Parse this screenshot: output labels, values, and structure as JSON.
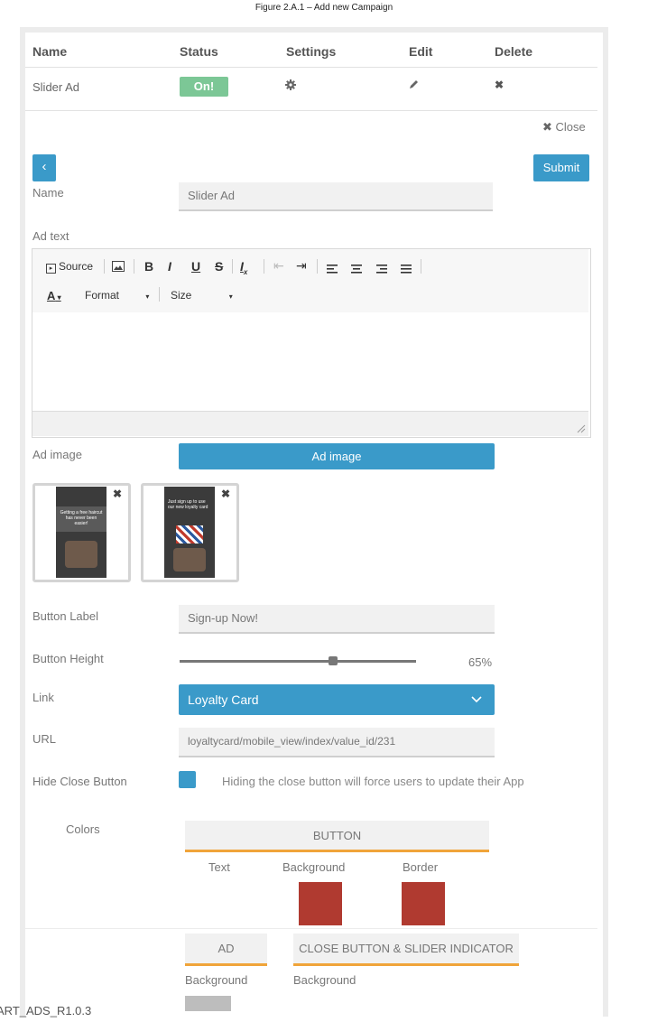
{
  "caption": "Figure 2.A.1 – Add new Campaign",
  "table": {
    "headers": [
      "Name",
      "Status",
      "Settings",
      "Edit",
      "Delete"
    ],
    "row": {
      "name": "Slider Ad",
      "status": "On!"
    }
  },
  "close_label": "Close",
  "back_label": "‹",
  "submit_label": "Submit",
  "form": {
    "name_label": "Name",
    "name_value": "Slider Ad",
    "ad_text_label": "Ad text",
    "ad_image_label": "Ad image",
    "ad_image_button": "Ad image",
    "button_label_label": "Button Label",
    "button_label_value": "Sign-up Now!",
    "button_height_label": "Button Height",
    "button_height_value": "65%",
    "button_height_fraction": 0.65,
    "link_label": "Link",
    "link_value": "Loyalty Card",
    "url_label": "URL",
    "url_value": "loyaltycard/mobile_view/index/value_id/231",
    "hide_close_label": "Hide Close Button",
    "hide_close_note": "Hiding the close button will force users to update their App",
    "colors_label": "Colors"
  },
  "editor": {
    "source": "Source",
    "format": "Format",
    "size": "Size"
  },
  "thumbs": [
    {
      "caption": "Getting a free haircut has never been easier!"
    },
    {
      "caption": "Just sign up to use our new loyalty card"
    }
  ],
  "colors": {
    "button_tab": "BUTTON",
    "text": "Text",
    "background": "Background",
    "border": "Border",
    "ad_tab": "AD",
    "close_tab": "CLOSE BUTTON & SLIDER INDICATOR",
    "ad_background": "Background",
    "close_background": "Background",
    "bg_swatch_color": "#b03a30",
    "border_swatch_color": "#b03a30",
    "ad_swatch_color": "#bdbdbd"
  },
  "footer_text": "ART_ADS_R1.0.3"
}
